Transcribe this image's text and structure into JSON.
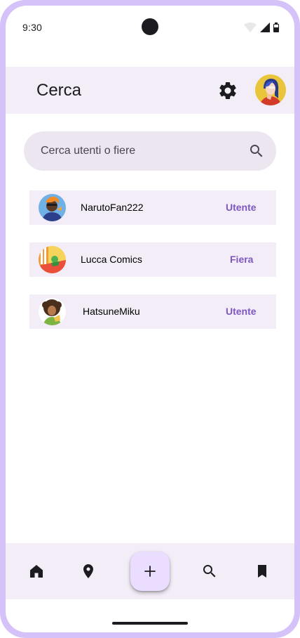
{
  "status_bar": {
    "time": "9:30"
  },
  "header": {
    "title": "Cerca"
  },
  "search": {
    "placeholder": "Cerca utenti o fiere",
    "value": ""
  },
  "results": [
    {
      "name": "NarutoFan222",
      "type": "Utente",
      "avatar_icon": "user-avatar-orange-hair"
    },
    {
      "name": "Lucca Comics",
      "type": "Fiera",
      "avatar_icon": "fair-avatar-comics"
    },
    {
      "name": "HatsuneMiku",
      "type": "Utente",
      "avatar_icon": "user-avatar-curly-hair"
    }
  ],
  "bottom_nav": {
    "items": [
      "home-icon",
      "location-pin-icon",
      "add-icon",
      "search-icon",
      "bookmark-icon"
    ],
    "fab_label": "+"
  },
  "colors": {
    "frame": "#d4c2f8",
    "surface": "#f3edf7",
    "search_bg": "#ece6f0",
    "accent": "#7e57c2",
    "fab": "#eaddff"
  }
}
